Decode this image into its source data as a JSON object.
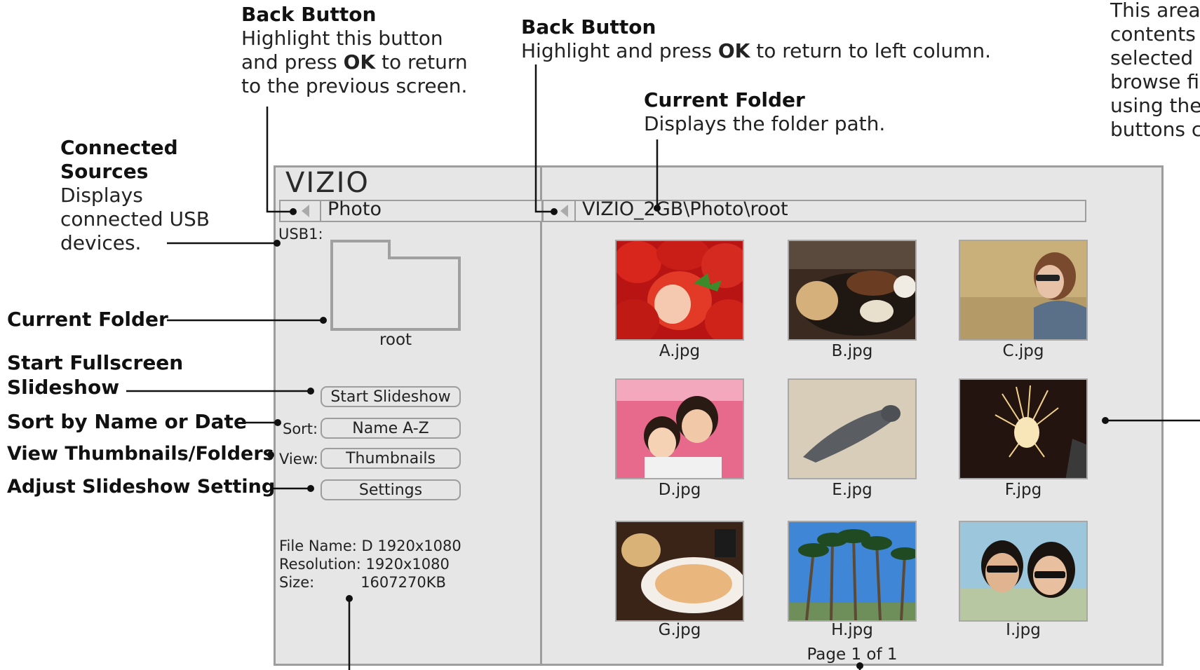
{
  "annotations": {
    "back_left": {
      "title": "Back Button",
      "text_1": "Highlight this button",
      "text_2a": "and press ",
      "text_2b": "OK",
      "text_2c": " to return",
      "text_3": "to the previous screen."
    },
    "back_right": {
      "title": "Back Button",
      "text_a": "Highlight and press ",
      "text_b": "OK",
      "text_c": " to return to left column."
    },
    "current_folder_top": {
      "title": "Current Folder",
      "text": "Displays the folder path."
    },
    "top_right": {
      "line_1": "This area",
      "line_2": "contents",
      "line_3": "selected",
      "line_4": "browse fi",
      "line_5": "using the",
      "line_6": "buttons c"
    },
    "connected_sources": {
      "title_1": "Connected",
      "title_2": "Sources",
      "text_1": "Displays",
      "text_2": "connected USB",
      "text_3": "devices."
    },
    "current_folder_left": "Current Folder",
    "start_slideshow": {
      "line_1": "Start Fullscreen",
      "line_2": "Slideshow"
    },
    "sort": "Sort by Name or Date",
    "view": "View Thumbnails/Folders",
    "settings": "Adjust Slideshow Settings"
  },
  "screen": {
    "logo": "VIZIO",
    "left_bar_label": "Photo",
    "path": "VIZIO_2GB\\Photo\\root",
    "source": "USB1:",
    "folder_name": "root",
    "start_button": "Start Slideshow",
    "sort_label": "Sort:",
    "sort_value": "Name A-Z",
    "view_label": "View:",
    "view_value": "Thumbnails",
    "settings_button": "Settings",
    "file_info": {
      "name_label": "File Name:",
      "name_value": "D 1920x1080",
      "res_label": "Resolution:",
      "res_value": "1920x1080",
      "size_label": "Size:",
      "size_value": "1607270KB"
    },
    "thumbnails": [
      "A.jpg",
      "B.jpg",
      "C.jpg",
      "D.jpg",
      "E.jpg",
      "F.jpg",
      "G.jpg",
      "H.jpg",
      "I.jpg"
    ],
    "page": "Page 1 of 1"
  },
  "colors": {
    "screen_bg": "#e6e6e6",
    "border": "#9d9d9d",
    "line": "#111111"
  }
}
